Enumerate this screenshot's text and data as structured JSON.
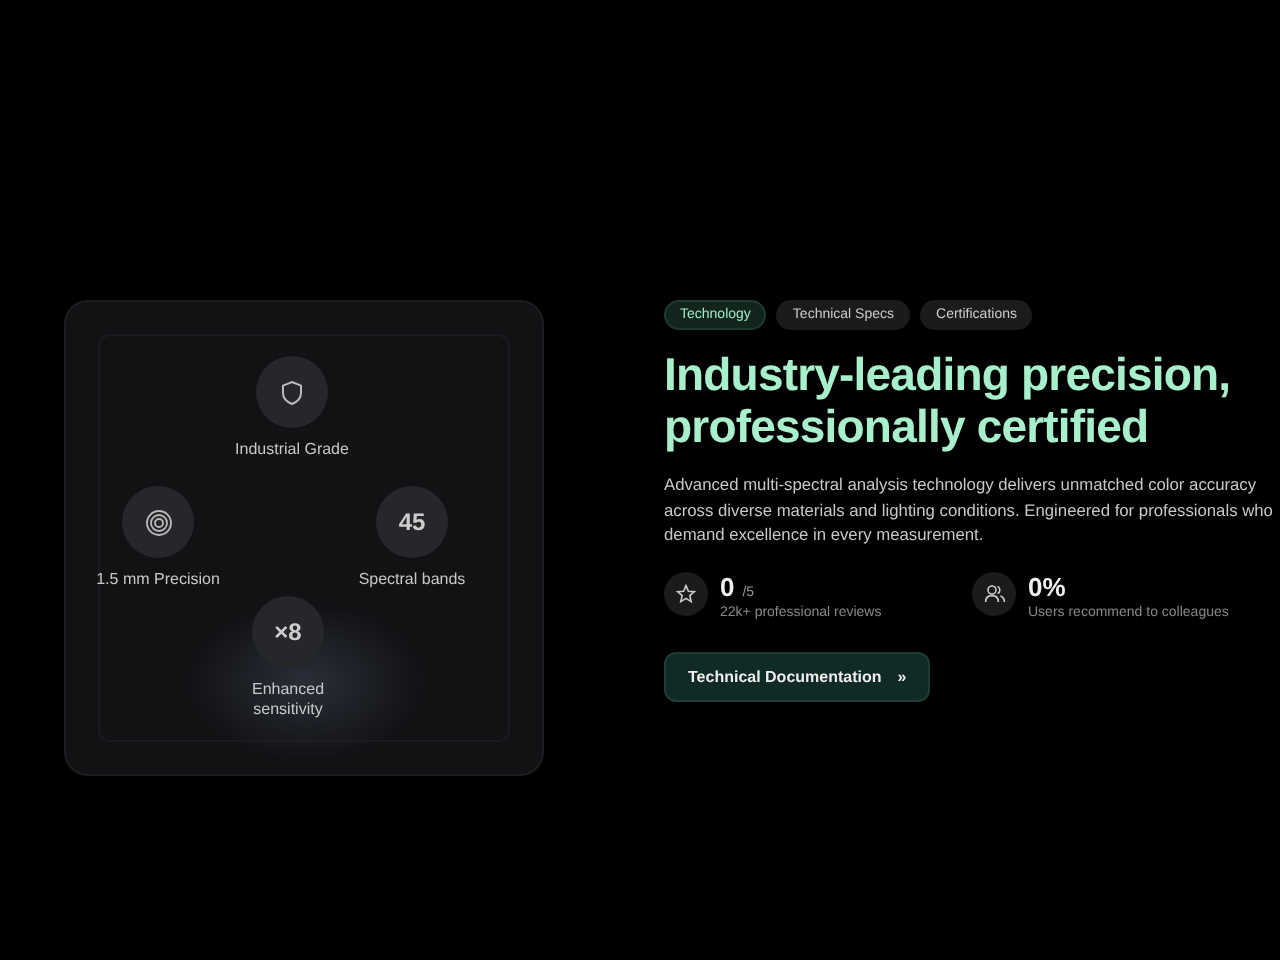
{
  "features": [
    {
      "kind": "shield",
      "label": "Industrial Grade"
    },
    {
      "kind": "rings",
      "label": "1.5 mm Precision"
    },
    {
      "kind": "text",
      "badge": "45",
      "label": "Spectral bands"
    },
    {
      "kind": "text",
      "badge": "×8",
      "label": "Enhanced sensitivity"
    }
  ],
  "tabs": [
    {
      "label": "Technology",
      "selected": true
    },
    {
      "label": "Technical Specs",
      "selected": false
    },
    {
      "label": "Certifications",
      "selected": false
    }
  ],
  "heading": "Industry-leading precision, professionally certified",
  "description": "Advanced multi-spectral analysis technology delivers unmatched color accuracy across diverse materials and lighting conditions. Engineered for professionals who demand excellence in every measurement.",
  "stats": [
    {
      "kind": "star",
      "value": "0",
      "suffix": "/5",
      "caption": "22k+ professional reviews"
    },
    {
      "kind": "people",
      "value": "0%",
      "caption": "Users recommend to colleagues"
    }
  ],
  "button": {
    "label": "Technical Documentation",
    "arrow": "»"
  }
}
